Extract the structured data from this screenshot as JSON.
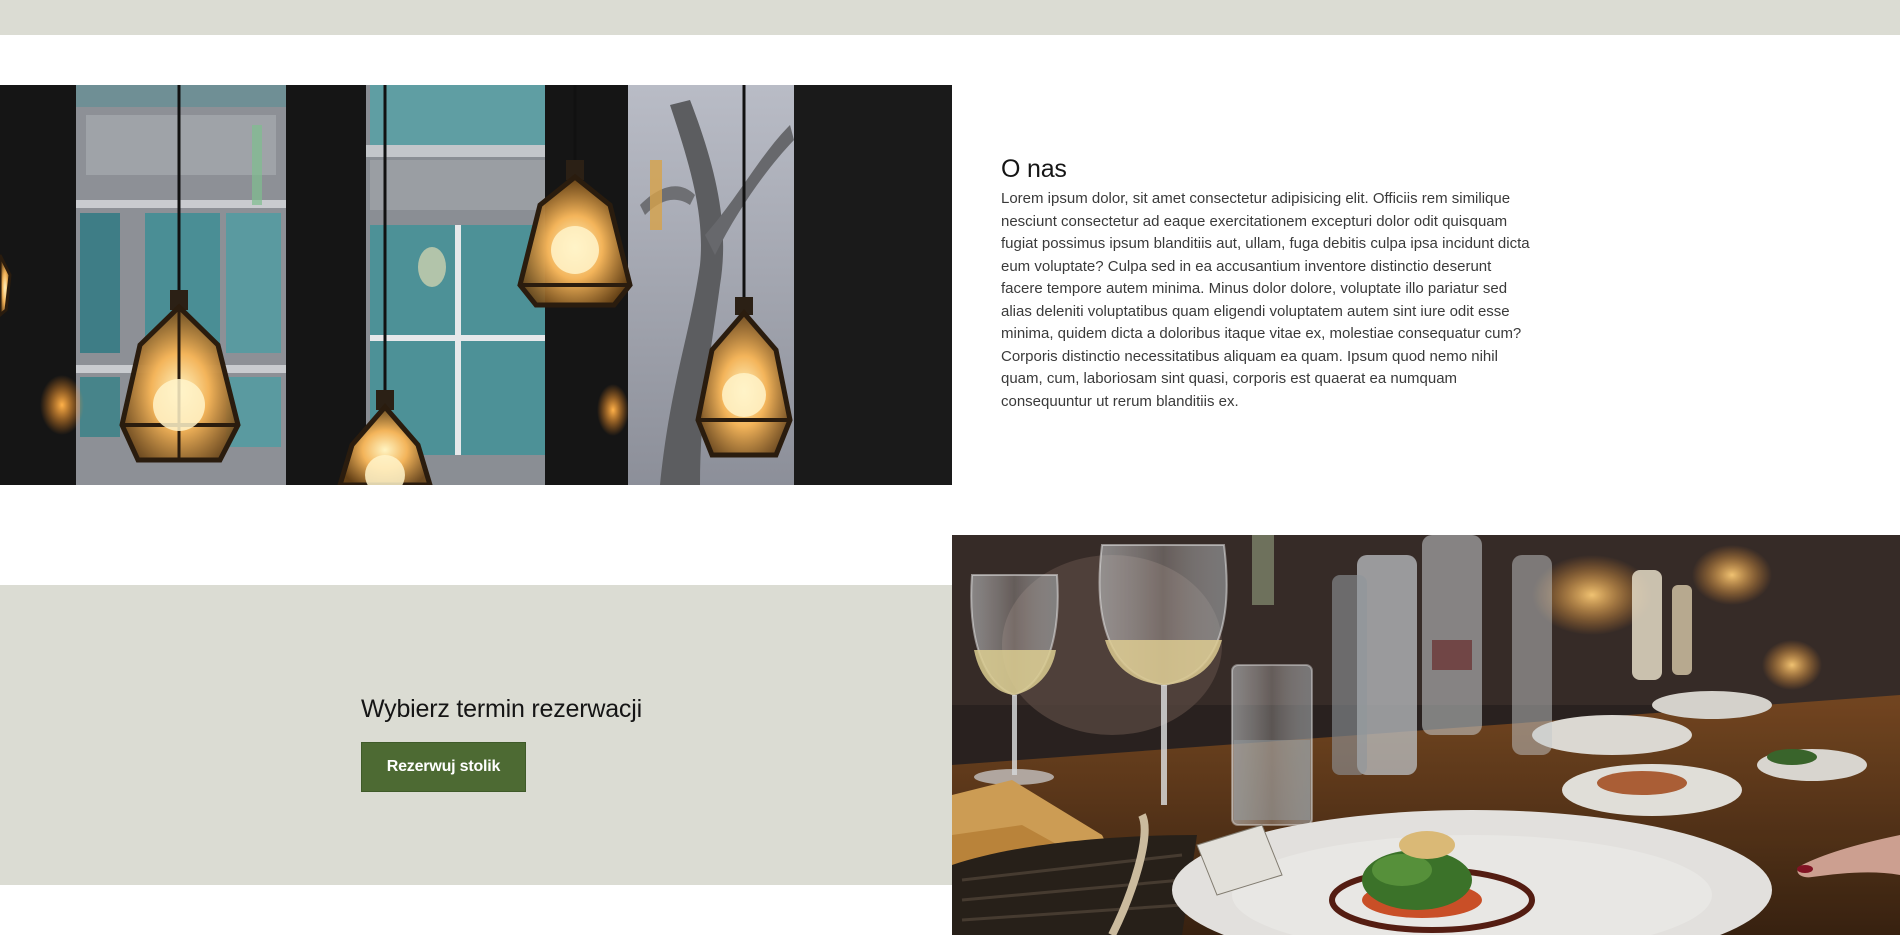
{
  "images": {
    "lamps": "Pendant lamps hanging in front of a window",
    "dining": "Restaurant table with wine glasses and plated dish"
  },
  "about": {
    "title": "O nas",
    "text": "Lorem ipsum dolor, sit amet consectetur adipisicing elit. Officiis rem similique nesciunt consectetur ad eaque exercitationem excepturi dolor odit quisquam fugiat possimus ipsum blanditiis aut, ullam, fuga debitis culpa ipsa incidunt dicta eum voluptate? Culpa sed in ea accusantium inventore distinctio deserunt facere tempore autem minima. Minus dolor dolore, voluptate illo pariatur sed alias deleniti voluptatibus quam eligendi voluptatem autem sint iure odit esse minima, quidem dicta a doloribus itaque vitae ex, molestiae consequatur cum? Corporis distinctio necessitatibus aliquam ea quam. Ipsum quod nemo nihil quam, cum, laboriosam sint quasi, corporis est quaerat ea numquam consequuntur ut rerum blanditiis ex."
  },
  "reservation": {
    "title": "Wybierz termin rezerwacji",
    "button_label": "Rezerwuj stolik"
  },
  "colors": {
    "band": "#dbdcd3",
    "accent": "#4d6a33",
    "background": "#ffffff"
  }
}
